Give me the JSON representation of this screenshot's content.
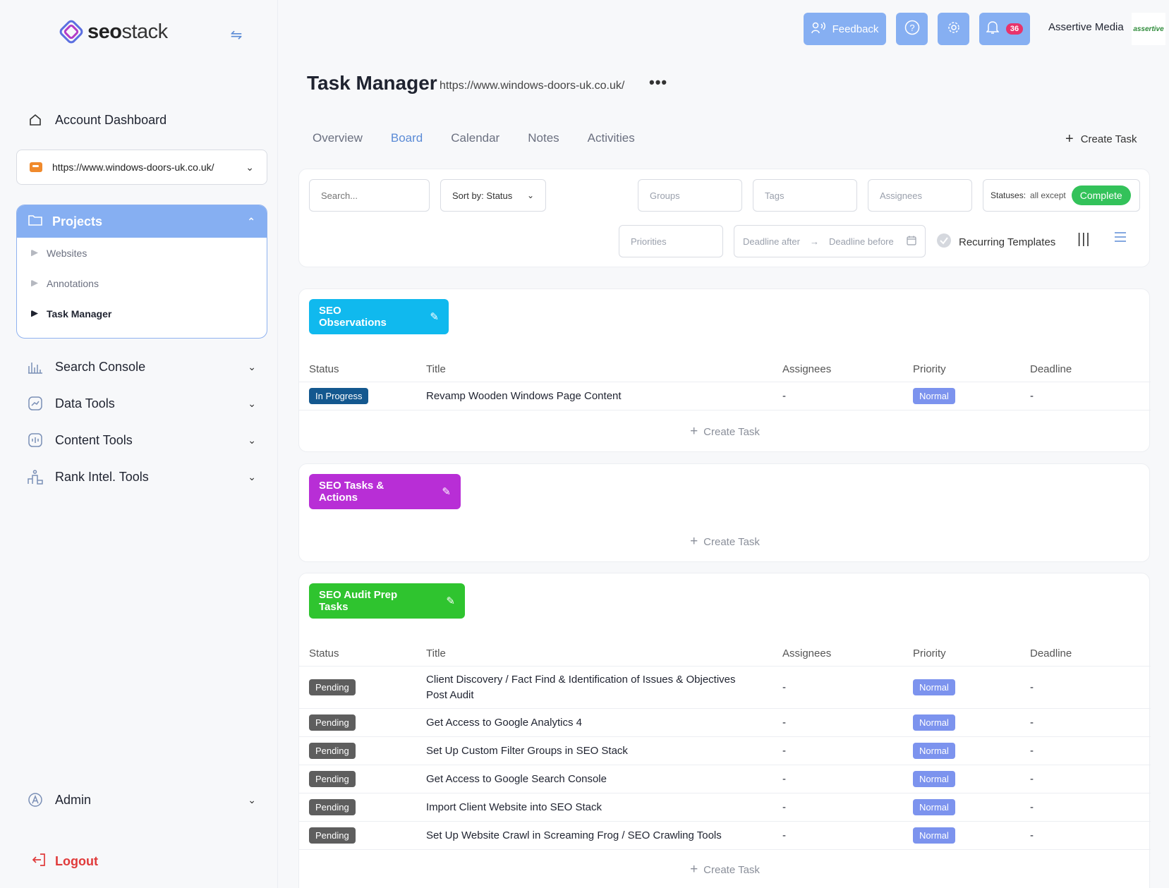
{
  "brand": {
    "name_bold": "seo",
    "name_light": "stack"
  },
  "sidebar": {
    "dashboard": "Account Dashboard",
    "site_select": "https://www.windows-doors-uk.co.uk/",
    "projects": {
      "label": "Projects",
      "items": [
        {
          "label": "Websites",
          "active": false
        },
        {
          "label": "Annotations",
          "active": false
        },
        {
          "label": "Task Manager",
          "active": true
        }
      ]
    },
    "sections": [
      "Search Console",
      "Data Tools",
      "Content Tools",
      "Rank Intel. Tools"
    ],
    "admin": "Admin",
    "logout": "Logout"
  },
  "topbar": {
    "feedback": "Feedback",
    "notifications_count": "36",
    "account_name": "Assertive Media",
    "account_logo": "assertive"
  },
  "page": {
    "title": "Task Manager",
    "url": "https://www.windows-doors-uk.co.uk/",
    "more": "•••"
  },
  "tabs": [
    {
      "label": "Overview",
      "active": false
    },
    {
      "label": "Board",
      "active": true
    },
    {
      "label": "Calendar",
      "active": false
    },
    {
      "label": "Notes",
      "active": false
    },
    {
      "label": "Activities",
      "active": false
    }
  ],
  "create_task_label": "Create Task",
  "filters": {
    "search_placeholder": "Search...",
    "sort": "Sort by: Status",
    "groups": "Groups",
    "tags": "Tags",
    "assignees": "Assignees",
    "statuses_label": "Statuses:",
    "statuses_except": "all except",
    "statuses_value": "Complete",
    "priorities": "Priorities",
    "deadline_after": "Deadline after",
    "deadline_before": "Deadline before",
    "recurring": "Recurring Templates"
  },
  "columns": {
    "status": "Status",
    "title": "Title",
    "assignees": "Assignees",
    "priority": "Priority",
    "deadline": "Deadline"
  },
  "groups": [
    {
      "name": "SEO Observations",
      "color": "#10b9ee",
      "tasks": [
        {
          "status": "In Progress",
          "title": "Revamp Wooden Windows Page Content",
          "assignees": "-",
          "priority": "Normal",
          "deadline": "-"
        }
      ]
    },
    {
      "name": "SEO Tasks & Actions",
      "color": "#b82ed6",
      "tasks": []
    },
    {
      "name": "SEO Audit Prep Tasks",
      "color": "#2fc42f",
      "tasks": [
        {
          "status": "Pending",
          "title": "Client Discovery / Fact Find & Identification of Issues & Objectives",
          "title2": "Post Audit",
          "assignees": "-",
          "priority": "Normal",
          "deadline": "-"
        },
        {
          "status": "Pending",
          "title": "Get Access to Google Analytics 4",
          "assignees": "-",
          "priority": "Normal",
          "deadline": "-"
        },
        {
          "status": "Pending",
          "title": "Set Up Custom Filter Groups in SEO Stack",
          "assignees": "-",
          "priority": "Normal",
          "deadline": "-"
        },
        {
          "status": "Pending",
          "title": "Get Access to Google Search Console",
          "assignees": "-",
          "priority": "Normal",
          "deadline": "-"
        },
        {
          "status": "Pending",
          "title": "Import Client Website into SEO Stack",
          "assignees": "-",
          "priority": "Normal",
          "deadline": "-"
        },
        {
          "status": "Pending",
          "title": "Set Up Website Crawl in Screaming Frog / SEO Crawling Tools",
          "assignees": "-",
          "priority": "Normal",
          "deadline": "-"
        }
      ]
    }
  ],
  "colors": {
    "accent": "#86aff2",
    "in_progress": "#14588f",
    "pending": "#5e5e5e",
    "priority_normal": "#7c93ee",
    "logout": "#e03a3a"
  }
}
